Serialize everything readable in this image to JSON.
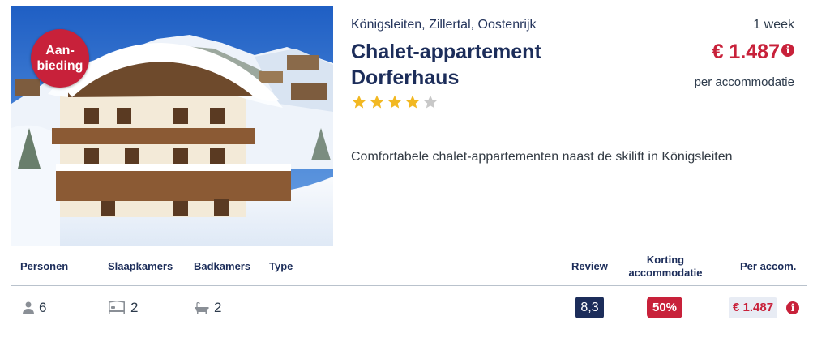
{
  "listing": {
    "badge_line1": "Aan-",
    "badge_line2": "bieding",
    "location": "Königsleiten, Zillertal, Oostenrijk",
    "title": "Chalet-appartement Dorferhaus",
    "rating_stars": 4,
    "rating_max": 5,
    "duration": "1 week",
    "price": "€ 1.487",
    "price_note": "per accommodatie",
    "description": "Comfortabele chalet-appartementen naast de skilift in Königsleiten",
    "photo_icon": "chalet-photo"
  },
  "table": {
    "headers": {
      "persons": "Personen",
      "bedrooms": "Slaapkamers",
      "bathrooms": "Badkamers",
      "type": "Type",
      "review": "Review",
      "discount_line1": "Korting",
      "discount_line2": "accommodatie",
      "per_accom": "Per accom."
    },
    "row": {
      "persons": "6",
      "bedrooms": "2",
      "bathrooms": "2",
      "type": "",
      "review": "8,3",
      "discount": "50%",
      "price": "€ 1.487"
    },
    "icons": {
      "persons": "person-icon",
      "bedrooms": "bed-icon",
      "bathrooms": "bathtub-icon",
      "info": "info-icon"
    }
  },
  "colors": {
    "navy": "#1c2d5a",
    "red": "#c8213a",
    "star_filled": "#f2b822",
    "star_empty": "#c8c8c8",
    "price_bg": "#e8ecf4"
  }
}
